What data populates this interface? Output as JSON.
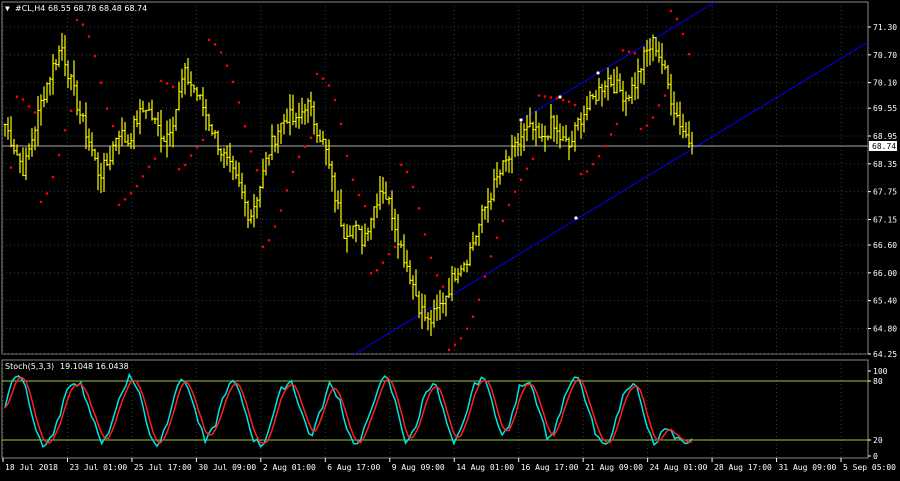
{
  "main_header": {
    "symbol_label": "#CL,H4",
    "ohlc": "68.55 68.78 68.48 68.74"
  },
  "stoch_header": {
    "label": "Stoch(5,3,3)",
    "values": "19.1048 16.0438"
  },
  "price_axis": {
    "ticks": [
      "71.30",
      "70.70",
      "70.10",
      "69.55",
      "68.95",
      "68.35",
      "67.75",
      "67.15",
      "66.60",
      "66.00",
      "65.40",
      "64.80",
      "64.25"
    ],
    "current_price": "68.74"
  },
  "stoch_axis": {
    "ticks": [
      "100",
      "80",
      "20",
      "0"
    ],
    "levels": [
      80,
      20
    ]
  },
  "time_axis": {
    "ticks": [
      "18 Jul 2018",
      "23 Jul 01:00",
      "25 Jul 17:00",
      "30 Jul 09:00",
      "2 Aug 01:00",
      "6 Aug 17:00",
      "9 Aug 09:00",
      "14 Aug 01:00",
      "16 Aug 17:00",
      "21 Aug 09:00",
      "24 Aug 01:00",
      "28 Aug 17:00",
      "31 Aug 09:00",
      "5 Sep 05:00"
    ]
  },
  "colors": {
    "background": "#000000",
    "bars": "#ffff00",
    "sar_dots": "#ff0000",
    "channel": "#0000ff",
    "grid": "#5a5a5a",
    "stoch_main": "#00e5e5",
    "stoch_signal": "#ff2020",
    "stoch_levels": "#9acd32",
    "axis_text": "#ffffff"
  },
  "chart_data": {
    "type": "ohlc",
    "symbol": "#CL",
    "timeframe": "H4",
    "ylim": [
      64.25,
      71.3
    ],
    "y_approx": [
      69.2,
      68.7,
      68.2,
      69.0,
      69.8,
      70.4,
      70.9,
      70.1,
      69.4,
      68.8,
      68.1,
      68.4,
      69.1,
      68.8,
      69.3,
      69.6,
      69.2,
      68.9,
      69.4,
      70.3,
      70.0,
      69.6,
      69.1,
      68.6,
      68.2,
      67.8,
      67.2,
      67.8,
      68.6,
      69.1,
      69.4,
      69.2,
      69.7,
      69.2,
      68.7,
      67.7,
      66.9,
      67.0,
      66.7,
      67.3,
      67.9,
      67.4,
      66.6,
      66.0,
      65.3,
      64.9,
      65.2,
      65.6,
      66.1,
      66.3,
      66.8,
      67.4,
      67.9,
      68.3,
      68.6,
      69.0,
      69.1,
      68.8,
      69.2,
      68.9,
      68.7,
      69.3,
      69.6,
      69.9,
      70.2,
      70.0,
      69.8,
      70.1,
      70.7,
      71.0,
      70.4,
      69.6,
      69.1,
      68.74
    ],
    "stoch_main_approx": [
      60,
      95,
      90,
      40,
      10,
      20,
      60,
      90,
      85,
      50,
      15,
      30,
      70,
      95,
      80,
      30,
      10,
      40,
      85,
      90,
      50,
      15,
      35,
      75,
      90,
      60,
      20,
      10,
      45,
      80,
      90,
      55,
      20,
      50,
      85,
      70,
      25,
      10,
      40,
      80,
      95,
      60,
      15,
      30,
      75,
      90,
      50,
      10,
      35,
      80,
      95,
      70,
      20,
      40,
      85,
      90,
      55,
      15,
      45,
      80,
      95,
      60,
      20,
      10,
      40,
      80,
      90,
      45,
      10,
      30,
      25,
      15,
      19
    ]
  }
}
